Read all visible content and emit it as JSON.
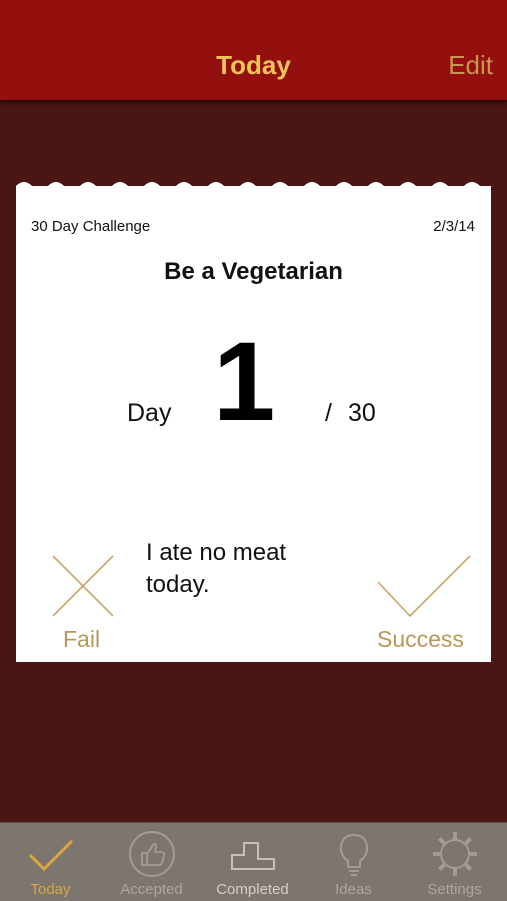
{
  "nav": {
    "title": "Today",
    "edit_label": "Edit"
  },
  "card": {
    "label": "30 Day Challenge",
    "date": "2/3/14",
    "title": "Be a Vegetarian",
    "day_label": "Day",
    "day_number": "1",
    "slash": "/",
    "total": "30",
    "description": "I ate no meat today.",
    "fail_label": "Fail",
    "success_label": "Success"
  },
  "tabs": [
    {
      "label": "Today",
      "icon": "check-icon",
      "active": true
    },
    {
      "label": "Accepted",
      "icon": "thumbs-up-icon",
      "active": false
    },
    {
      "label": "Completed",
      "icon": "podium-icon",
      "active": false
    },
    {
      "label": "Ideas",
      "icon": "lightbulb-icon",
      "active": false
    },
    {
      "label": "Settings",
      "icon": "gear-icon",
      "active": false
    }
  ],
  "colors": {
    "nav_bg": "#93100f",
    "page_bg": "#4a1512",
    "title_gold": "#f0c45a",
    "accent_gold": "#b9975a",
    "tabbar_bg": "#7c766e"
  }
}
